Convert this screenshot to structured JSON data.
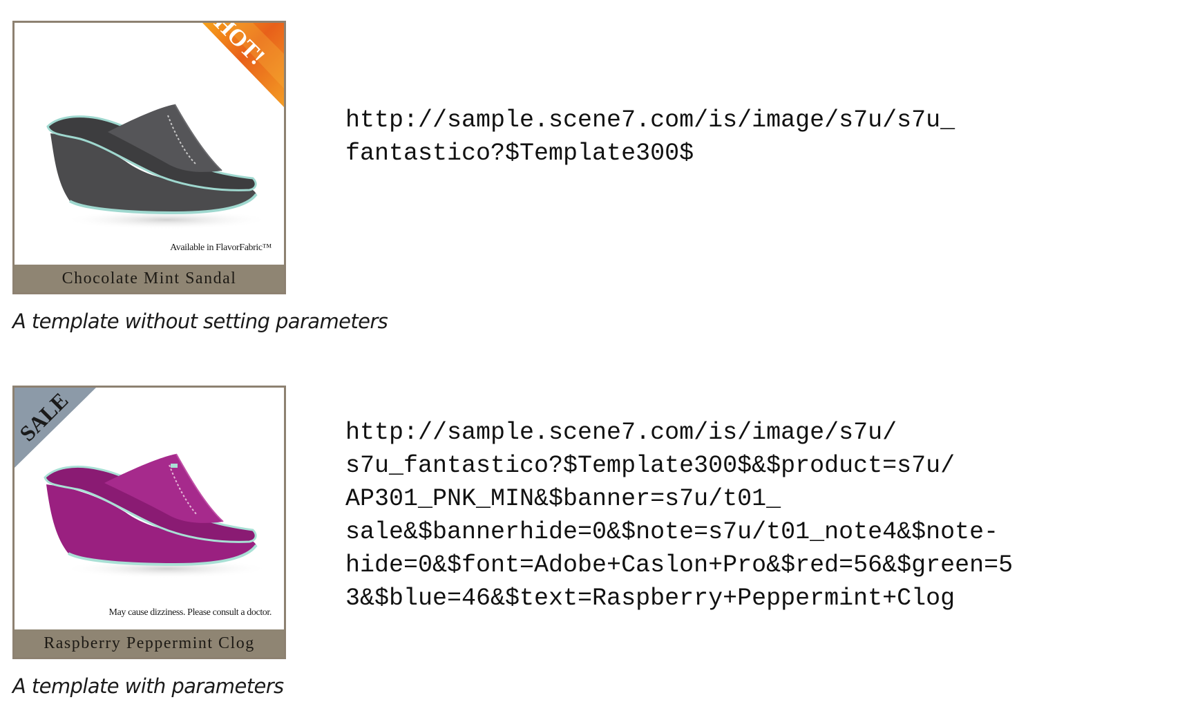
{
  "examples": [
    {
      "card": {
        "badge": "HOT!",
        "note": "Available in FlavorFabric™",
        "product_name": "Chocolate Mint Sandal",
        "shoe_color": "#4b4b4d",
        "trim_color": "#9fd8cf"
      },
      "caption": "A template without setting parameters",
      "url_lines": [
        "http://sample.scene7.com/is/image/s7u/s7u_",
        "fantastico?$Template300$"
      ]
    },
    {
      "card": {
        "badge": "SALE",
        "note": "May cause dizziness. Please consult a doctor.",
        "product_name": "Raspberry Peppermint Clog",
        "shoe_color": "#9a2080",
        "trim_color": "#a9e0d5"
      },
      "caption": "A template with parameters",
      "url_lines": [
        "http://sample.scene7.com/is/image/s7u/",
        "s7u_fantastico?$Template300$&$product=s7u/",
        "AP301_PNK_MIN&$banner=s7u/t01_",
        "sale&$bannerhide=0&$note=s7u/t01_note4&$note-",
        "hide=0&$font=Adobe+Caslon+Pro&$red=56&$green=5",
        "3&$blue=46&$text=Raspberry+Peppermint+Clog"
      ]
    }
  ],
  "colors": {
    "card_border": "#8d8171",
    "label_bar": "#8f8573",
    "hot_banner": "#e8731c",
    "sale_banner": "#8c9aa8"
  }
}
